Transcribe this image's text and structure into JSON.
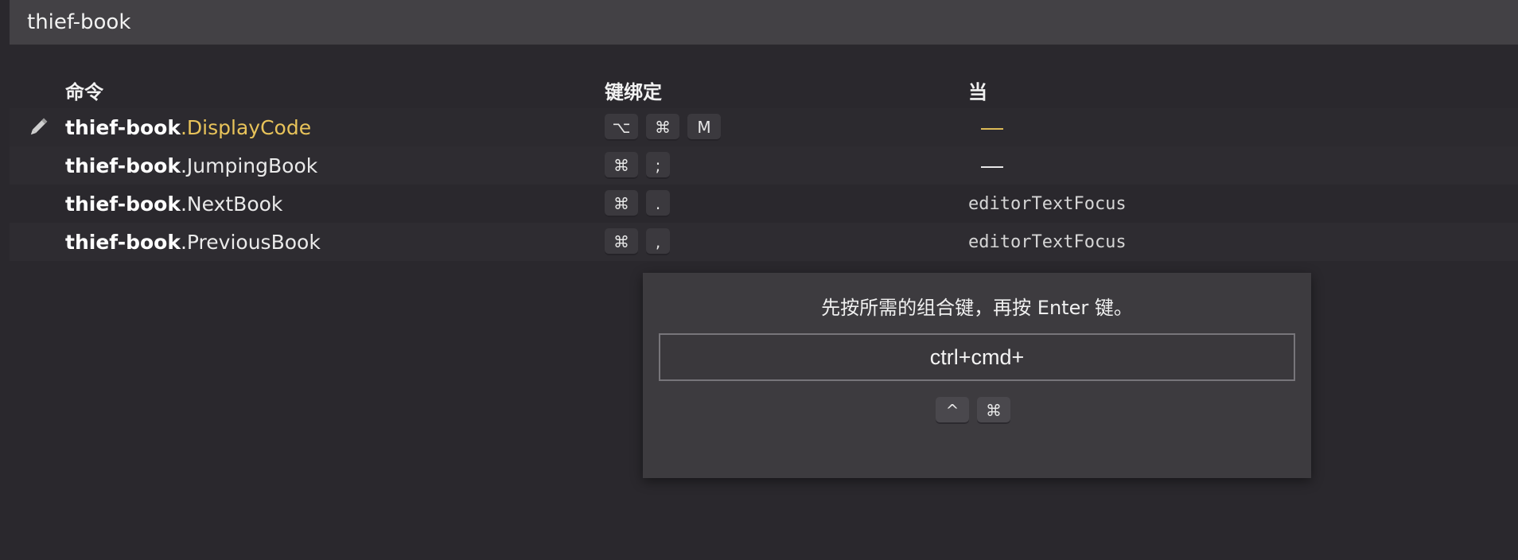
{
  "search": {
    "value": "thief-book"
  },
  "table": {
    "headers": {
      "command": "命令",
      "keybinding": "键绑定",
      "when": "当"
    },
    "rows": [
      {
        "ext": "thief-book",
        "sep": ".",
        "name": "DisplayCode",
        "keys": [
          "⌥",
          "⌘",
          "M"
        ],
        "when": "—"
      },
      {
        "ext": "thief-book",
        "sep": ".",
        "name": "JumpingBook",
        "keys": [
          "⌘",
          ";"
        ],
        "when": "—"
      },
      {
        "ext": "thief-book",
        "sep": ".",
        "name": "NextBook",
        "keys": [
          "⌘",
          "."
        ],
        "when": "editorTextFocus"
      },
      {
        "ext": "thief-book",
        "sep": ".",
        "name": "PreviousBook",
        "keys": [
          "⌘",
          ","
        ],
        "when": "editorTextFocus"
      }
    ]
  },
  "dialog": {
    "message": "先按所需的组合键，再按 Enter 键。",
    "input_value": "ctrl+cmd+",
    "keys": [
      "^",
      "⌘"
    ]
  },
  "colors": {
    "highlight": "#e8c35a",
    "background": "#2a282d",
    "panel": "#3d3b3f"
  },
  "icons": {
    "edit": "pencil-icon"
  }
}
